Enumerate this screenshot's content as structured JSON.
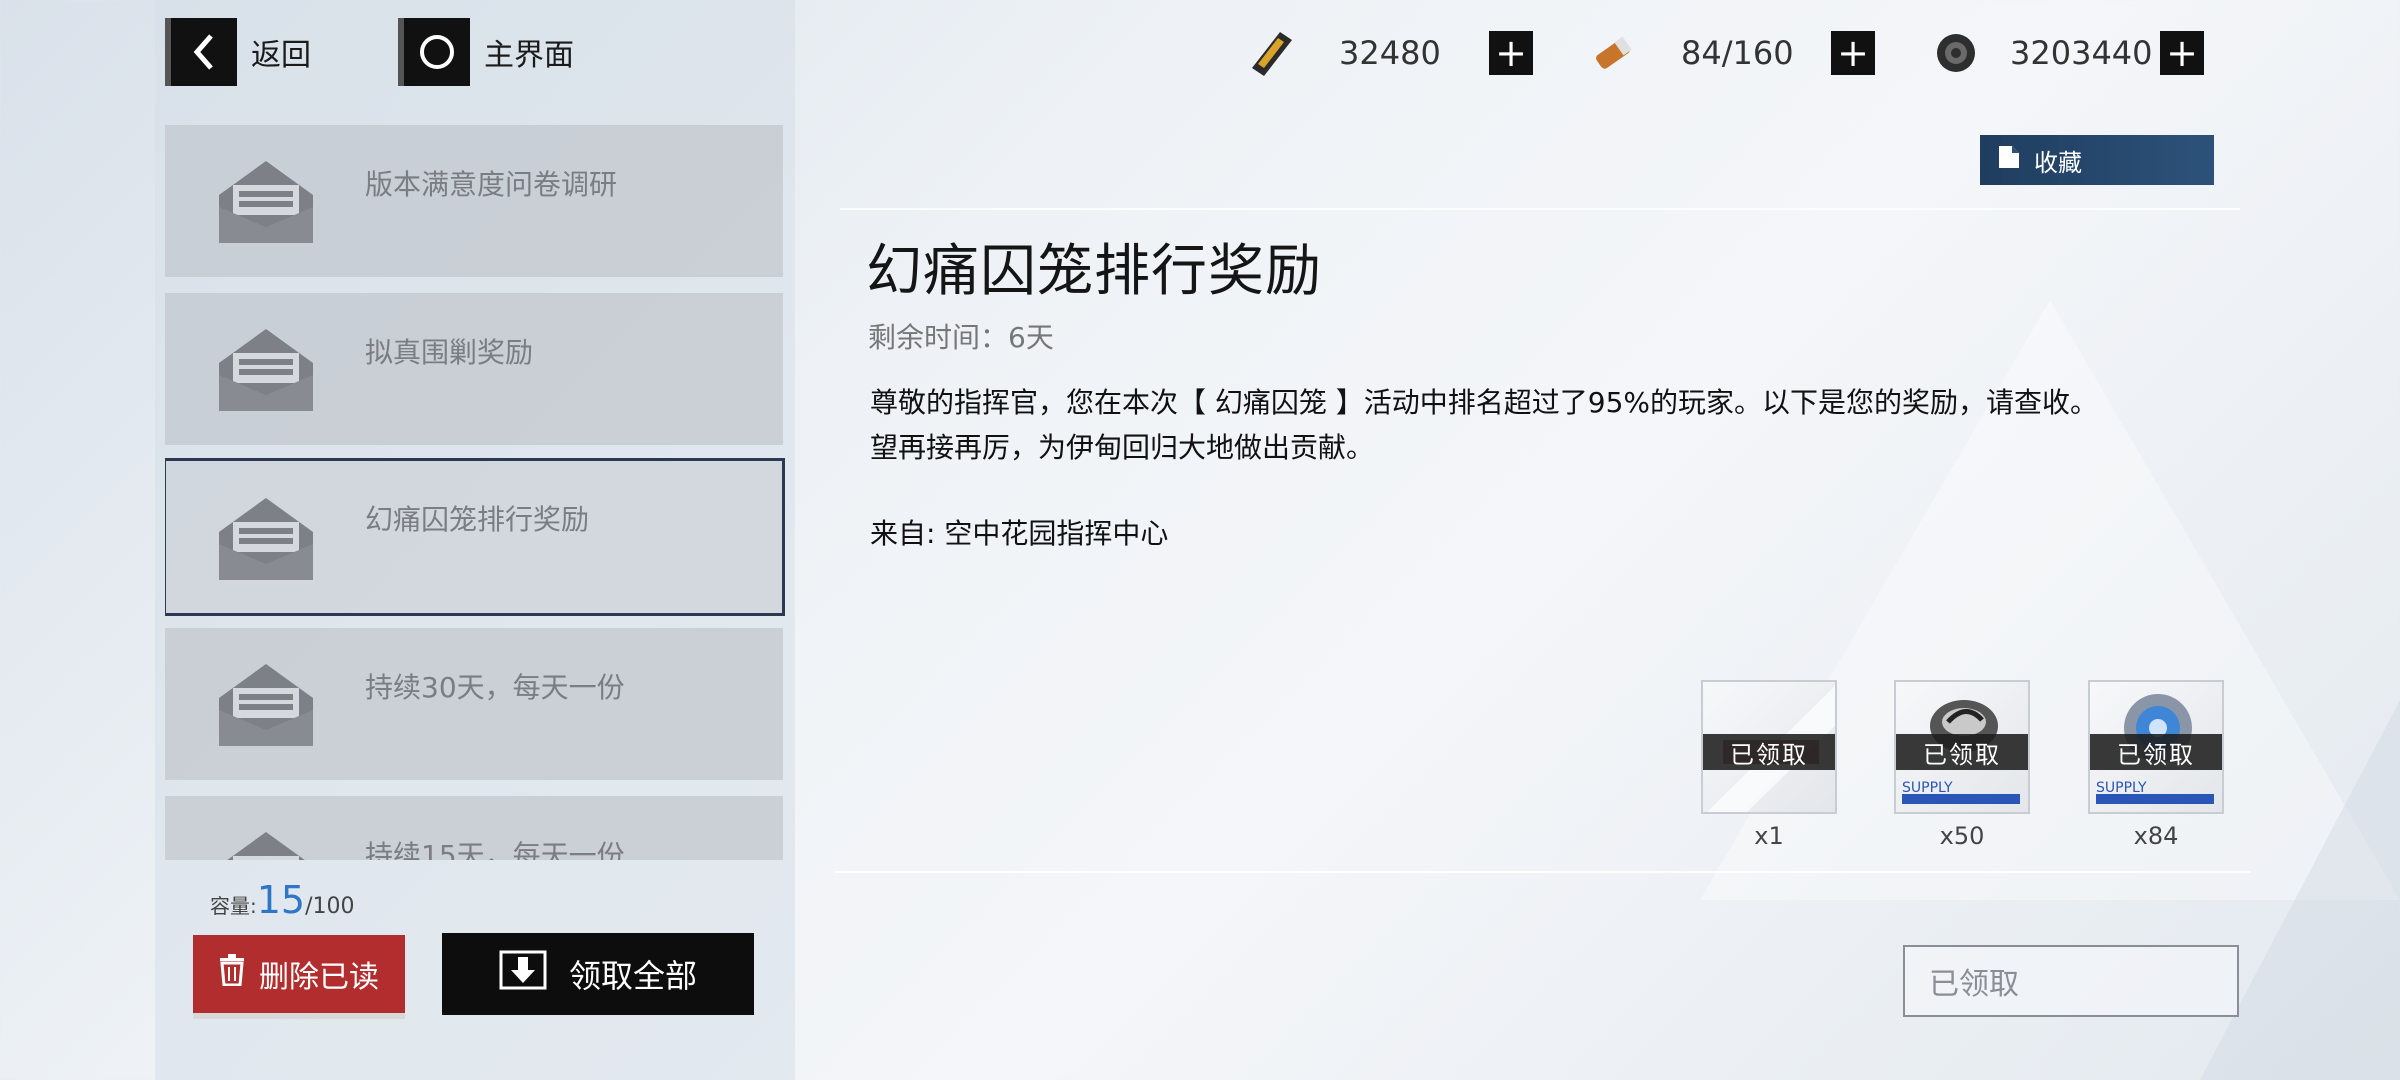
{
  "nav": {
    "back_label": "返回",
    "home_label": "主界面"
  },
  "currencies": [
    {
      "icon": "gold-bar-icon",
      "value": "32480"
    },
    {
      "icon": "stamina-capsule-icon",
      "value": "84/160"
    },
    {
      "icon": "coin-icon",
      "value": "3203440"
    }
  ],
  "mail_list": [
    {
      "title": "版本满意度问卷调研",
      "selected": false
    },
    {
      "title": "拟真围剿奖励",
      "selected": false
    },
    {
      "title": "幻痛囚笼排行奖励",
      "selected": true
    },
    {
      "title": "持续30天，每天一份",
      "selected": false
    },
    {
      "title": "持续15天，每天一份",
      "selected": false
    }
  ],
  "capacity": {
    "label": "容量:",
    "count": "15",
    "max": "/100"
  },
  "buttons": {
    "delete_read": "删除已读",
    "claim_all": "领取全部",
    "favorite": "收藏",
    "claimed": "已领取"
  },
  "mail": {
    "title": "幻痛囚笼排行奖励",
    "remaining": "剩余时间：6天",
    "body_line1": "尊敬的指挥官，您在本次【 幻痛囚笼 】活动中排名超过了95%的玩家。以下是您的奖励，请查收。",
    "body_line2": "望再接再厉，为伊甸回归大地做出贡献。",
    "sender": "来自: 空中花园指挥中心"
  },
  "rewards": [
    {
      "icon": "crystal-ticket-icon",
      "status": "已领取",
      "qty": "x1",
      "supply": ""
    },
    {
      "icon": "cog-material-icon",
      "status": "已领取",
      "qty": "x50",
      "supply": "SUPPLY"
    },
    {
      "icon": "blue-gear-material-icon",
      "status": "已领取",
      "qty": "x84",
      "supply": "SUPPLY"
    }
  ]
}
